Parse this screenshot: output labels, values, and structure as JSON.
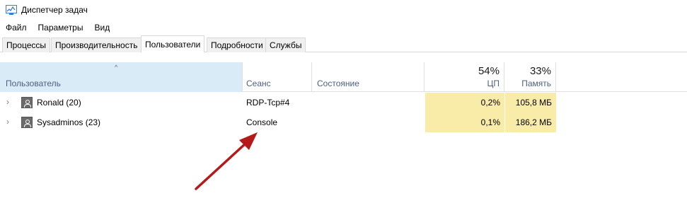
{
  "window": {
    "title": "Диспетчер задач"
  },
  "menu": {
    "items": [
      "Файл",
      "Параметры",
      "Вид"
    ]
  },
  "tabs": [
    "Процессы",
    "Производительность",
    "Пользователи",
    "Подробности",
    "Службы"
  ],
  "active_tab": "Пользователи",
  "columns": {
    "user": "Пользователь",
    "session": "Сеанс",
    "state": "Состояние",
    "cpu": {
      "label": "ЦП",
      "total": "54%"
    },
    "memory": {
      "label": "Память",
      "total": "33%"
    }
  },
  "rows": [
    {
      "name": "Ronald (20)",
      "session": "RDP-Tcp#4",
      "state": "",
      "cpu": "0,2%",
      "memory": "105,8 МБ"
    },
    {
      "name": "Sysadminos (23)",
      "session": "Console",
      "state": "",
      "cpu": "0,1%",
      "memory": "186,2 МБ"
    }
  ],
  "colors": {
    "selected_header": "#d9ebf7",
    "heat_cell": "#f9eca8",
    "annotation_arrow": "#b51a1a"
  },
  "icons": {
    "app": "task-manager-icon",
    "sort": "sort-ascending-icon",
    "expand": "chevron-right-icon",
    "user": "user-icon"
  }
}
